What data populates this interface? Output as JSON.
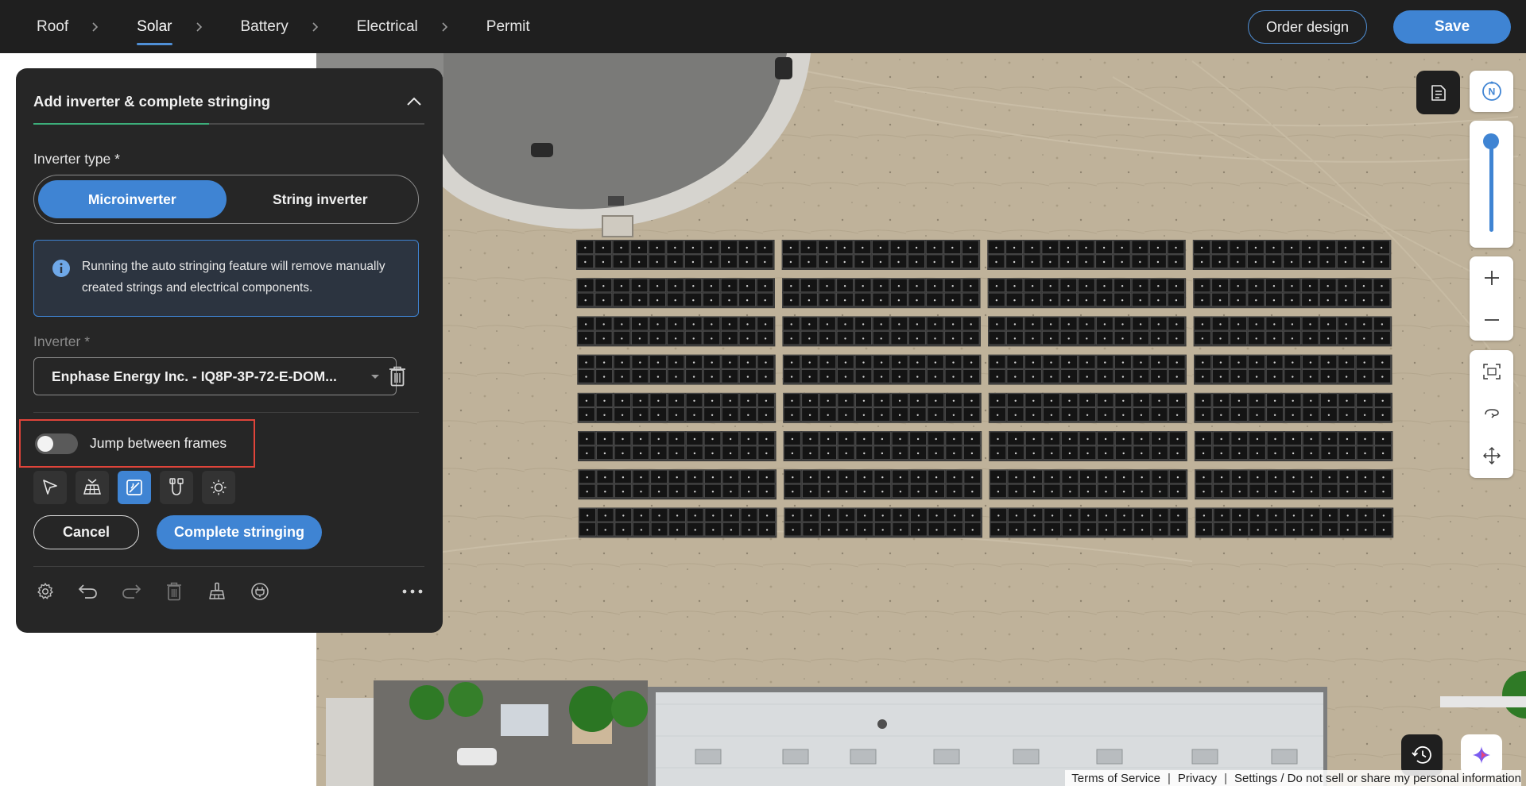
{
  "nav": {
    "steps": [
      {
        "label": "Roof"
      },
      {
        "label": "Solar"
      },
      {
        "label": "Battery"
      },
      {
        "label": "Electrical"
      },
      {
        "label": "Permit"
      }
    ],
    "active_step": "Solar",
    "order_design_label": "Order design",
    "save_label": "Save"
  },
  "panel": {
    "title": "Add inverter & complete stringing",
    "progress_fraction": 0.45,
    "inverter_type_label": "Inverter type *",
    "inverter_types": [
      "Microinverter",
      "String inverter"
    ],
    "selected_inverter_type": "Microinverter",
    "info_text_line1": "Running the auto stringing feature will remove manually",
    "info_text_line2": "created strings and electrical components.",
    "inverter_label": "Inverter *",
    "inverter_value": "Enphase Energy Inc. - IQ8P-3P-72-E-DOM...",
    "jump_between_frames_label": "Jump between frames",
    "jump_between_frames_on": false,
    "cancel_label": "Cancel",
    "complete_label": "Complete stringing"
  },
  "map_controls": {
    "compass_letter": "N",
    "zoom_level_fraction": 1.0
  },
  "footer": {
    "terms": "Terms of Service",
    "privacy": "Privacy",
    "settings": "Settings / Do not sell or share my personal information"
  },
  "colors": {
    "accent": "#3f84d3",
    "topbar": "#1f1f1f",
    "panel_bg": "#262626",
    "highlight_box": "#e0443a",
    "progress": "#3cae7a"
  }
}
